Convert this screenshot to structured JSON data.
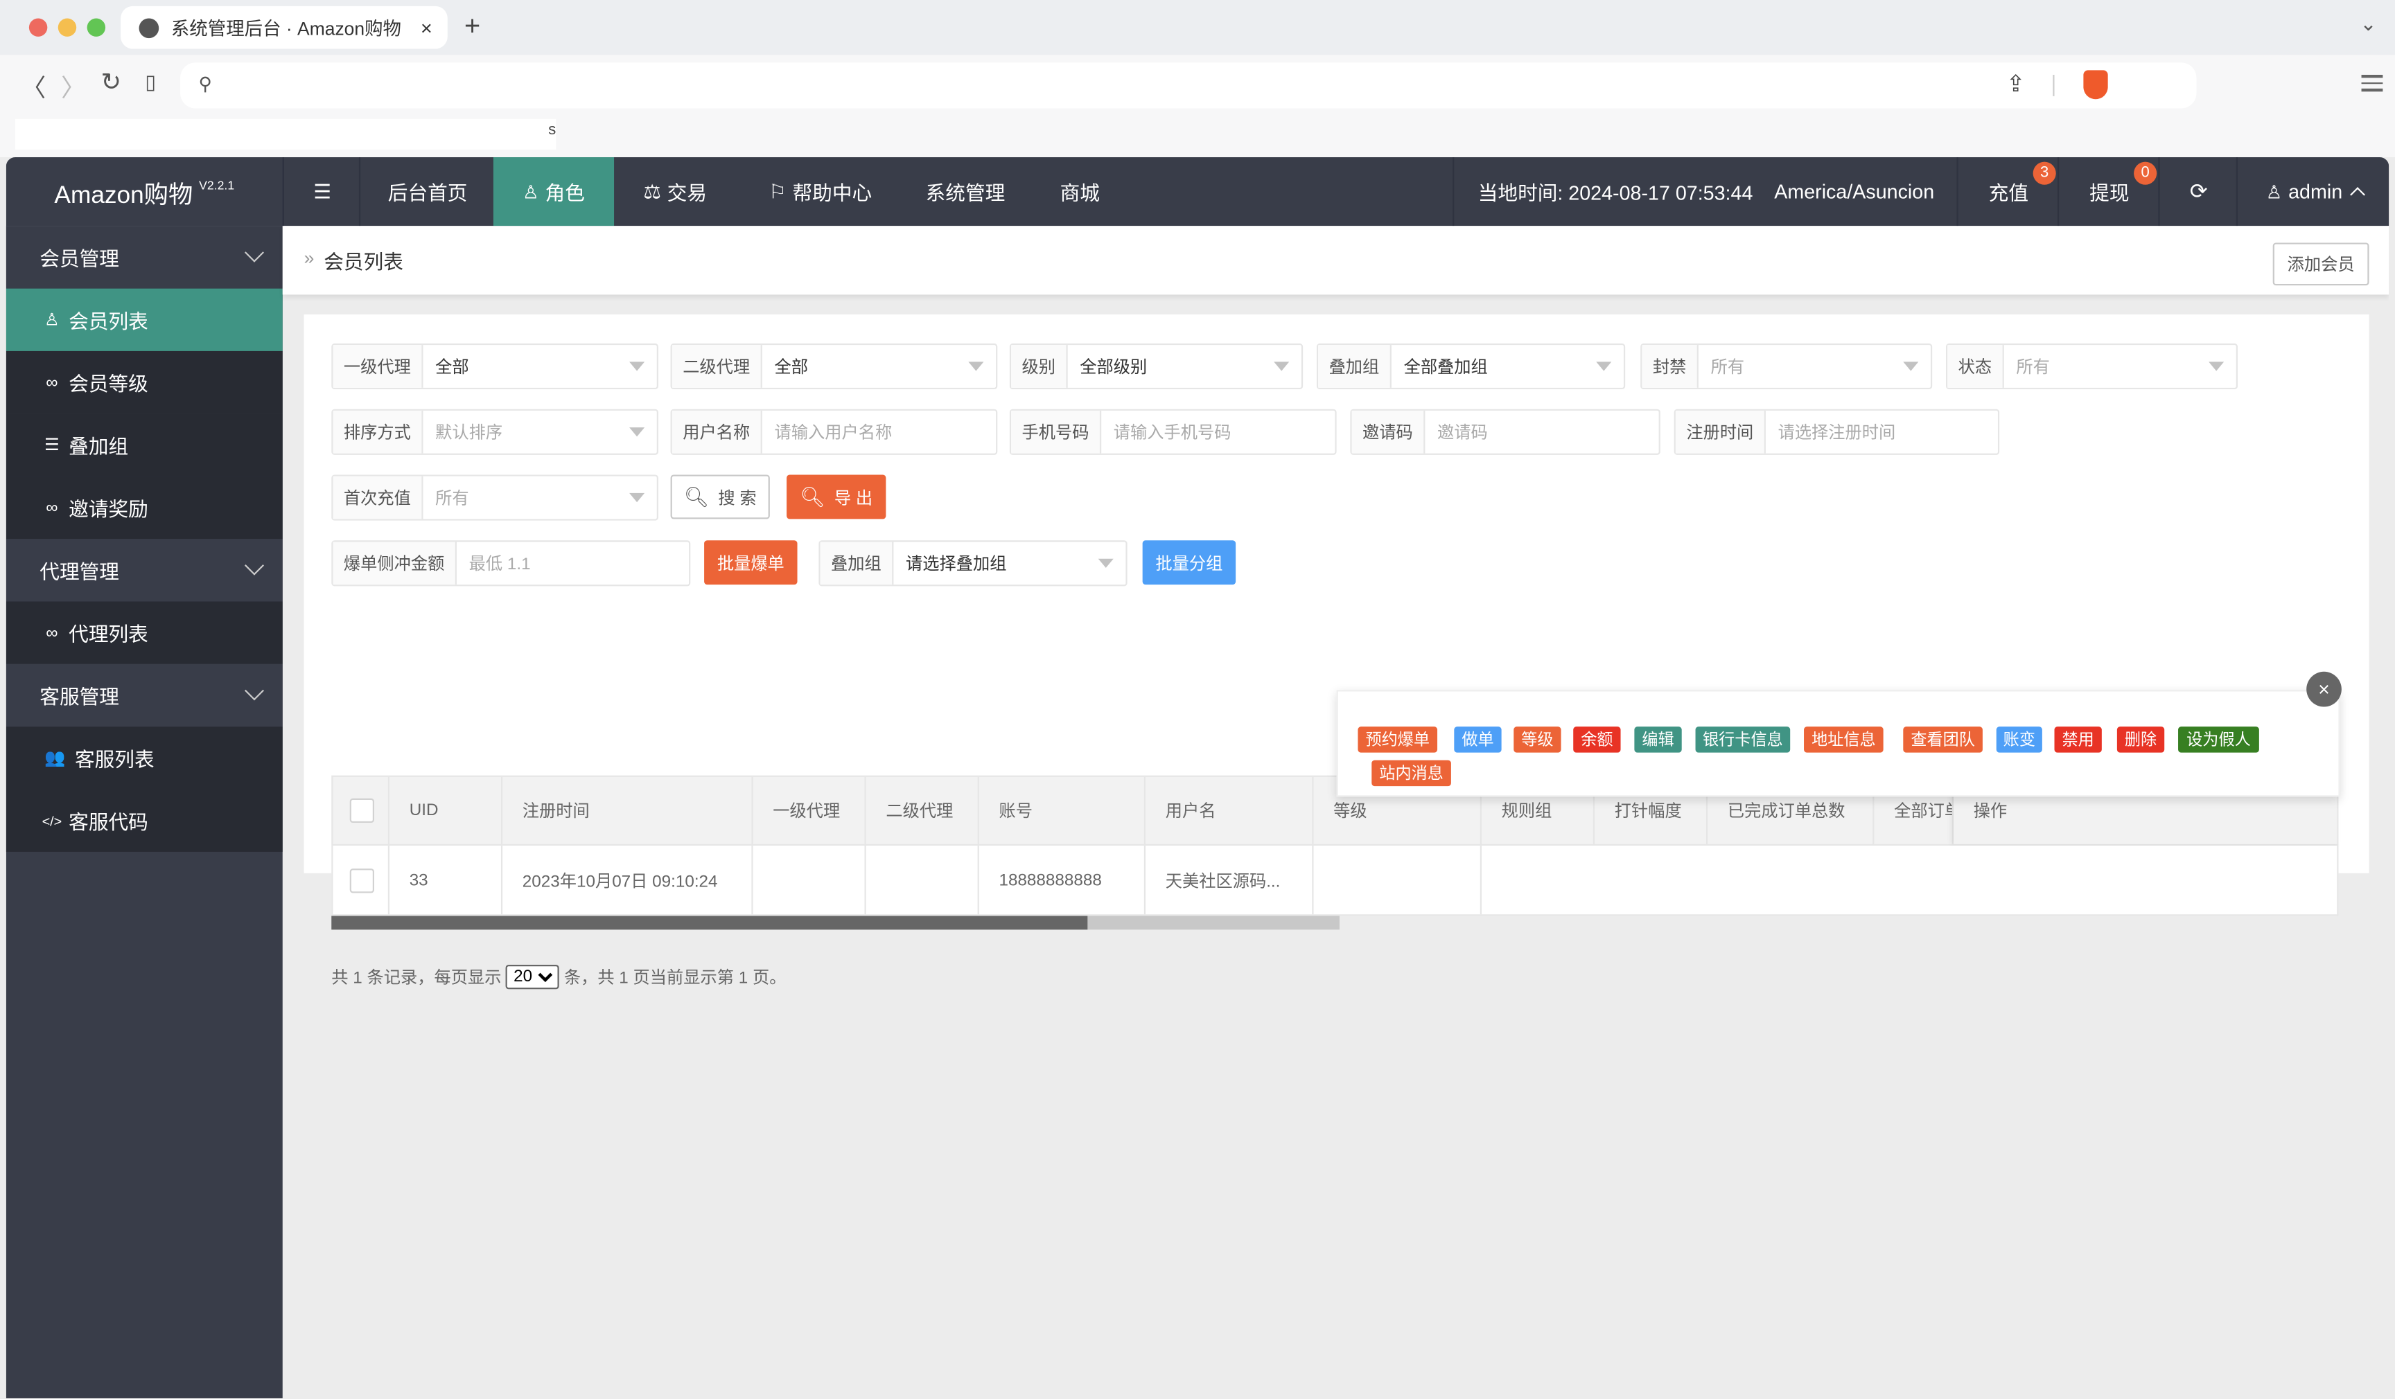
{
  "browser": {
    "tab_title": "系统管理后台 · Amazon购物",
    "tab_close": "×",
    "new_tab": "+",
    "tabs_menu": "⌄",
    "back": "〈",
    "forward": "〉",
    "reload": "↻",
    "bookmark": "🔖",
    "bookmark_char": "s"
  },
  "header": {
    "app_name": "Amazon购物",
    "version": "V2.2.1",
    "menu_toggle": "☰",
    "nav": [
      {
        "label": "后台首页",
        "icon": ""
      },
      {
        "label": "角色",
        "icon": "user-icon",
        "active": true
      },
      {
        "label": "交易",
        "icon": "scale-icon"
      },
      {
        "label": "帮助中心",
        "icon": "flag-icon"
      },
      {
        "label": "系统管理",
        "icon": ""
      },
      {
        "label": "商城",
        "icon": ""
      }
    ],
    "local_time_label": "当地时间: 2024-08-17 07:53:44",
    "timezone": "America/Asuncion",
    "recharge": {
      "label": "充值",
      "badge": "3"
    },
    "withdraw": {
      "label": "提现",
      "badge": "0"
    },
    "refresh": "⟳",
    "user": "admin"
  },
  "icons": {
    "user": "♙",
    "scale": "⚖",
    "flag": "⚐",
    "link": "🔗",
    "list": "☰",
    "users": "👥",
    "code": "</>",
    "search": "⌕",
    "crumb": "»",
    "close": "×"
  },
  "sidebar": {
    "groups": [
      {
        "label": "会员管理",
        "items": [
          {
            "label": "会员列表",
            "icon": "user-icon",
            "active": true
          },
          {
            "label": "会员等级",
            "icon": "link-icon"
          },
          {
            "label": "叠加组",
            "icon": "list-icon"
          },
          {
            "label": "邀请奖励",
            "icon": "link-icon"
          }
        ]
      },
      {
        "label": "代理管理",
        "items": [
          {
            "label": "代理列表",
            "icon": "link-icon"
          }
        ]
      },
      {
        "label": "客服管理",
        "items": [
          {
            "label": "客服列表",
            "icon": "users-icon"
          },
          {
            "label": "客服代码",
            "icon": "code-icon"
          }
        ]
      }
    ]
  },
  "breadcrumb": {
    "current": "会员列表"
  },
  "add_member_button": "添加会员",
  "filters": {
    "agent1": {
      "label": "一级代理",
      "value": "全部"
    },
    "agent2": {
      "label": "二级代理",
      "value": "全部"
    },
    "level": {
      "label": "级别",
      "value": "全部级别"
    },
    "group": {
      "label": "叠加组",
      "value": "全部叠加组"
    },
    "ban": {
      "label": "封禁",
      "placeholder": "所有"
    },
    "status": {
      "label": "状态",
      "placeholder": "所有"
    },
    "sort": {
      "label": "排序方式",
      "placeholder": "默认排序"
    },
    "username": {
      "label": "用户名称",
      "placeholder": "请输入用户名称"
    },
    "phone": {
      "label": "手机号码",
      "placeholder": "请输入手机号码"
    },
    "invite": {
      "label": "邀请码",
      "placeholder": "邀请码"
    },
    "regtime": {
      "label": "注册时间",
      "placeholder": "请选择注册时间"
    },
    "first_recharge": {
      "label": "首次充值",
      "placeholder": "所有"
    },
    "search_button": "搜 索",
    "export_button": "导 出",
    "burst_amount": {
      "label": "爆单侧冲金额",
      "placeholder": "最低 1.1"
    },
    "batch_burst_button": "批量爆单",
    "batch_group": {
      "label": "叠加组",
      "value": "请选择叠加组"
    },
    "batch_group_button": "批量分组"
  },
  "table": {
    "columns": [
      "UID",
      "注册时间",
      "一级代理",
      "二级代理",
      "账号",
      "用户名",
      "等级",
      "规则组",
      "打针幅度",
      "已完成订单总数",
      "全部订单",
      "操作"
    ],
    "rows": [
      {
        "uid": "33",
        "reg_time": "2023年10月07日 09:10:24",
        "agent1": "",
        "agent2": "",
        "account": "18888888888",
        "username": "天美社区源码...",
        "level": "",
        "rule_group": "",
        "inject": "",
        "done_orders": "",
        "all_orders": ""
      }
    ],
    "scroll_position": 0.75
  },
  "actions": [
    {
      "label": "预约爆单",
      "color": "#ec6437"
    },
    {
      "label": "做单",
      "color": "#4e9ff7"
    },
    {
      "label": "等级",
      "color": "#ec6437"
    },
    {
      "label": "余额",
      "color": "#e83325"
    },
    {
      "label": "编辑",
      "color": "#409484"
    },
    {
      "label": "银行卡信息",
      "color": "#409484"
    },
    {
      "label": "地址信息",
      "color": "#ec6437"
    },
    {
      "label": "查看团队",
      "color": "#ec6437"
    },
    {
      "label": "账变",
      "color": "#4e9ff7"
    },
    {
      "label": "禁用",
      "color": "#e83325"
    },
    {
      "label": "删除",
      "color": "#e83325"
    },
    {
      "label": "设为假人",
      "color": "#377f22"
    },
    {
      "label": "站内消息",
      "color": "#ec6437"
    }
  ],
  "pager": {
    "prefix": "共 1 条记录，每页显示",
    "page_size": "20",
    "suffix": "条，共 1 页当前显示第 1 页。"
  },
  "colors": {
    "header_bg": "#393d49",
    "accent": "#409484",
    "orange": "#ec6437",
    "blue": "#4e9ff7",
    "red": "#e83325",
    "green": "#377f22"
  }
}
